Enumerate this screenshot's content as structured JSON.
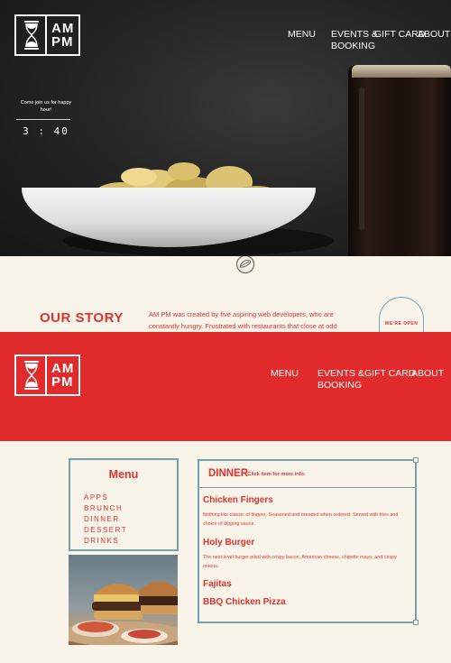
{
  "brand": {
    "line1": "AM",
    "line2": "PM"
  },
  "nav": [
    {
      "label": "MENU"
    },
    {
      "label": "EVENTS &\nBOOKING"
    },
    {
      "label": "GIFT CARD"
    },
    {
      "label": "ABOUT"
    }
  ],
  "happy_hour": {
    "message": "Come join us for happy hour!",
    "countdown": "3 : 40"
  },
  "story": {
    "title": "OUR STORY",
    "body": "AM PM was created by five aspiring web developers, who are constantly hungry. Frustrated with restaurants that close at odd",
    "badge": "WE'RE OPEN"
  },
  "menu": {
    "title": "Menu",
    "categories": [
      "APPS",
      "BRUNCH",
      "DINNER",
      "DESSERT",
      "DRINKS"
    ]
  },
  "dinner": {
    "title": "DINNER",
    "hint": "- Click item for more info.",
    "items": [
      {
        "name": "Chicken Fingers",
        "desc": "Nothing like classic of fingers. Seasoned and breaded when ordered. Served with fries and choice of dipping sauce."
      },
      {
        "name": "Holy Burger",
        "desc": "The next-level burger piled with crispy bacon, American cheese, chipotle mayo, and crispy onions."
      },
      {
        "name": "Fajitas",
        "desc": ""
      },
      {
        "name": "BBQ Chicken Pizza",
        "desc": ""
      }
    ]
  },
  "colors": {
    "red": "#e0322d",
    "cream": "#f8f4ea",
    "border": "#7a9db0",
    "dark": "#1a1a1a"
  }
}
